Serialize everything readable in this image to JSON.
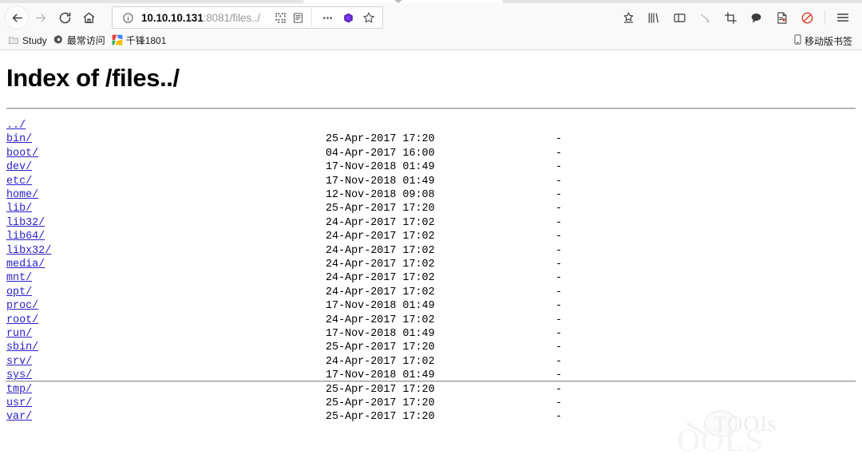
{
  "browser": {
    "nav": {
      "back_label": "Back",
      "forward_label": "Forward",
      "reload_label": "Reload",
      "home_label": "Home"
    },
    "urlbar": {
      "host": "10.10.10.131",
      "path": ":8081/files../",
      "full_url": "10.10.10.131:8081/files../",
      "info_icon": "page-info-icon",
      "qr_icon": "qr-code-icon",
      "reader_icon": "reader-view-icon",
      "more_icon": "more-actions-icon",
      "pocket_icon": "pocket-badge-icon",
      "bookmark_icon": "star-icon"
    },
    "toolbar_icons": [
      {
        "name": "save-to-pocket-icon",
        "label": "Save to Pocket"
      },
      {
        "name": "library-icon",
        "label": "Library"
      },
      {
        "name": "sidebar-icon",
        "label": "Sidebars"
      },
      {
        "name": "pointer-icon",
        "label": "Pointer"
      },
      {
        "name": "screenshot-crop-icon",
        "label": "Take a Screenshot"
      },
      {
        "name": "comment-icon",
        "label": "Comment"
      },
      {
        "name": "document-icon",
        "label": "Document"
      },
      {
        "name": "blocked-icon",
        "label": "Blocked"
      },
      {
        "name": "hamburger-menu-icon",
        "label": "Open menu"
      }
    ],
    "bookmarks": [
      {
        "label": "Study",
        "icon": "folder-icon"
      },
      {
        "label": "最常访问",
        "icon": "gear-icon"
      },
      {
        "label": "千锋1801",
        "icon": "colorful-logo-icon"
      }
    ],
    "mobile_bookmarks": {
      "label": "移动版书签",
      "icon": "phone-icon"
    }
  },
  "page": {
    "title": "Index of /files../",
    "watermark": {
      "small": "TOOIs",
      "big": "OOLS"
    },
    "listing": [
      {
        "name": "../",
        "date": "",
        "time": "",
        "size": ""
      },
      {
        "name": "bin/",
        "date": "25-Apr-2017",
        "time": "17:20",
        "size": "-"
      },
      {
        "name": "boot/",
        "date": "04-Apr-2017",
        "time": "16:00",
        "size": "-"
      },
      {
        "name": "dev/",
        "date": "17-Nov-2018",
        "time": "01:49",
        "size": "-"
      },
      {
        "name": "etc/",
        "date": "17-Nov-2018",
        "time": "01:49",
        "size": "-"
      },
      {
        "name": "home/",
        "date": "12-Nov-2018",
        "time": "09:08",
        "size": "-"
      },
      {
        "name": "lib/",
        "date": "25-Apr-2017",
        "time": "17:20",
        "size": "-"
      },
      {
        "name": "lib32/",
        "date": "24-Apr-2017",
        "time": "17:02",
        "size": "-"
      },
      {
        "name": "lib64/",
        "date": "24-Apr-2017",
        "time": "17:02",
        "size": "-"
      },
      {
        "name": "libx32/",
        "date": "24-Apr-2017",
        "time": "17:02",
        "size": "-"
      },
      {
        "name": "media/",
        "date": "24-Apr-2017",
        "time": "17:02",
        "size": "-"
      },
      {
        "name": "mnt/",
        "date": "24-Apr-2017",
        "time": "17:02",
        "size": "-"
      },
      {
        "name": "opt/",
        "date": "24-Apr-2017",
        "time": "17:02",
        "size": "-"
      },
      {
        "name": "proc/",
        "date": "17-Nov-2018",
        "time": "01:49",
        "size": "-"
      },
      {
        "name": "root/",
        "date": "24-Apr-2017",
        "time": "17:02",
        "size": "-"
      },
      {
        "name": "run/",
        "date": "17-Nov-2018",
        "time": "01:49",
        "size": "-"
      },
      {
        "name": "sbin/",
        "date": "25-Apr-2017",
        "time": "17:20",
        "size": "-"
      },
      {
        "name": "srv/",
        "date": "24-Apr-2017",
        "time": "17:02",
        "size": "-"
      },
      {
        "name": "sys/",
        "date": "17-Nov-2018",
        "time": "01:49",
        "size": "-"
      },
      {
        "name": "tmp/",
        "date": "25-Apr-2017",
        "time": "17:20",
        "size": "-"
      },
      {
        "name": "usr/",
        "date": "25-Apr-2017",
        "time": "17:20",
        "size": "-"
      },
      {
        "name": "var/",
        "date": "25-Apr-2017",
        "time": "17:20",
        "size": "-"
      }
    ]
  },
  "colors": {
    "link": "#2a20c8",
    "chrome_bg": "#f9f9fa",
    "pocket_purple": "#5b21b6",
    "blocked_red": "#d7381f"
  }
}
